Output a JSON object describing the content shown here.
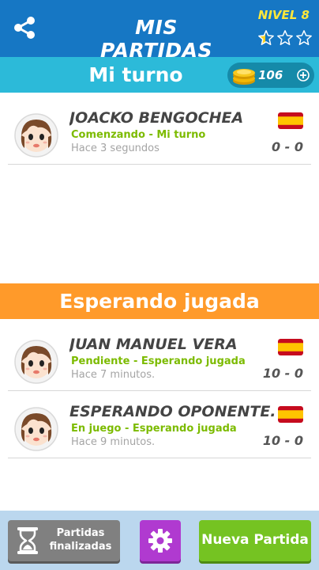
{
  "header": {
    "title": "MIS PARTIDAS",
    "level": "NIVEL 8",
    "stars_filled_fraction": 0.33,
    "brand_color": "#1677c4",
    "icons": {
      "share": "share-icon",
      "star": "star-icon"
    }
  },
  "my_turn": {
    "title": "Mi turno",
    "coins": "106",
    "color": "#2cbad9",
    "icons": {
      "coin": "coin-stack-icon",
      "add": "plus-circle-icon"
    },
    "games": [
      {
        "name": "JOACKO BENGOCHEA",
        "status": "Comenzando - Mi turno",
        "time": "Hace 3 segundos",
        "score": "0 - 0",
        "flag": "spain-flag-icon"
      }
    ]
  },
  "waiting": {
    "title": "Esperando jugada",
    "color": "#ff9a2a",
    "games": [
      {
        "name": "JUAN MANUEL VERA",
        "status": "Pendiente - Esperando jugada",
        "time": "Hace 7 minutos.",
        "score": "10 - 0",
        "flag": "spain-flag-icon"
      },
      {
        "name": "ESPERANDO OPONENTE...",
        "status": "En juego - Esperando jugada",
        "time": "Hace 9 minutos.",
        "score": "10 - 0",
        "flag": "spain-flag-icon"
      }
    ]
  },
  "footer": {
    "finished_line1": "Partidas",
    "finished_line2": "finalizadas",
    "new_game": "Nueva Partida",
    "icons": {
      "finished": "hourglass-icon",
      "settings": "gear-icon"
    },
    "colors": {
      "finished": "#808080",
      "settings": "#b03ad0",
      "new_game": "#75c322"
    }
  }
}
